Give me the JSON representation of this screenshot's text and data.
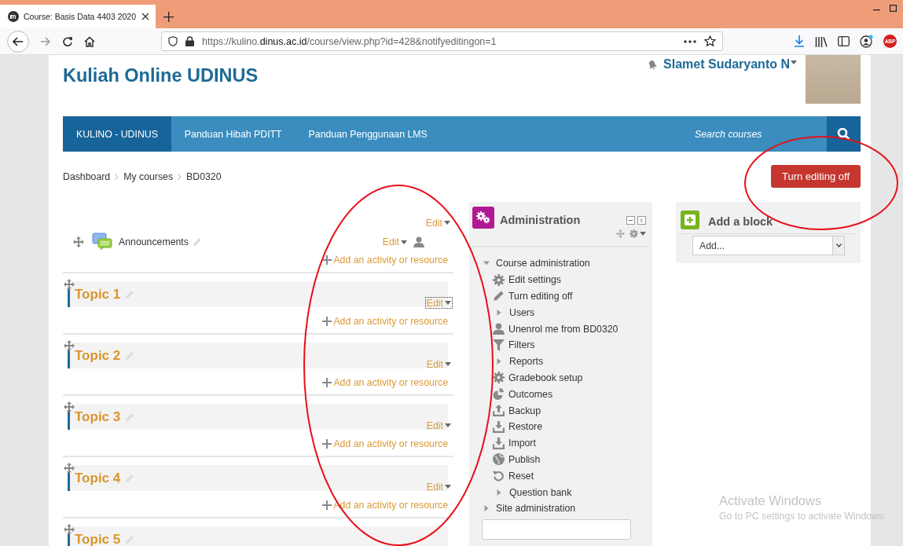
{
  "browser": {
    "tab_title": "Course: Basis Data 4403 2020",
    "url": "https://kulino.**dinus.ac.id**/course/view.php?id=428&notifyeditingon=1",
    "adblock_label": "ABP"
  },
  "site": {
    "title": "Kuliah Online UDINUS",
    "user_name": "Slamet Sudaryanto N"
  },
  "nav": {
    "items": [
      {
        "label": "KULINO - UDINUS",
        "selected": true
      },
      {
        "label": "Panduan Hibah PDITT",
        "selected": false
      },
      {
        "label": "Panduan Penggunaan LMS",
        "selected": false
      }
    ],
    "search": {
      "placeholder": "Search courses"
    }
  },
  "breadcrumb": [
    "Dashboard",
    "My courses",
    "BD0320"
  ],
  "editing_button": "Turn editing off",
  "course": {
    "section_edit": "Edit",
    "announcement": {
      "name": "Announcements",
      "edit": "Edit",
      "add": "Add an activity or resource"
    },
    "topics": [
      {
        "title": "Topic 1",
        "edit": "Edit",
        "focused": true,
        "add": "Add an activity or resource"
      },
      {
        "title": "Topic 2",
        "edit": "Edit",
        "focused": false,
        "add": "Add an activity or resource"
      },
      {
        "title": "Topic 3",
        "edit": "Edit",
        "focused": false,
        "add": "Add an activity or resource"
      },
      {
        "title": "Topic 4",
        "edit": "Edit",
        "focused": false,
        "add": "Add an activity or resource"
      },
      {
        "title": "Topic 5"
      }
    ]
  },
  "administration": {
    "title": "Administration",
    "items": [
      {
        "label": "Course administration",
        "kind": "branch",
        "expanded": true,
        "children": [
          {
            "label": "Edit settings",
            "kind": "gear"
          },
          {
            "label": "Turn editing off",
            "kind": "pencil"
          },
          {
            "label": "Users",
            "kind": "branch",
            "expanded": false
          },
          {
            "label": "Unenrol me from BD0320",
            "kind": "user"
          },
          {
            "label": "Filters",
            "kind": "filter"
          },
          {
            "label": "Reports",
            "kind": "branch",
            "expanded": false
          },
          {
            "label": "Gradebook setup",
            "kind": "gear"
          },
          {
            "label": "Outcomes",
            "kind": "outcomes"
          },
          {
            "label": "Backup",
            "kind": "upload"
          },
          {
            "label": "Restore",
            "kind": "download"
          },
          {
            "label": "Import",
            "kind": "download"
          },
          {
            "label": "Publish",
            "kind": "globe"
          },
          {
            "label": "Reset",
            "kind": "reset"
          },
          {
            "label": "Question bank",
            "kind": "branch",
            "expanded": false
          }
        ]
      },
      {
        "label": "Site administration",
        "kind": "branch",
        "expanded": false
      }
    ]
  },
  "add_block": {
    "title": "Add a block",
    "select": "Add..."
  },
  "os_notice": {
    "title": "Activate Windows",
    "text": "Go to PC settings to activate Windows."
  }
}
